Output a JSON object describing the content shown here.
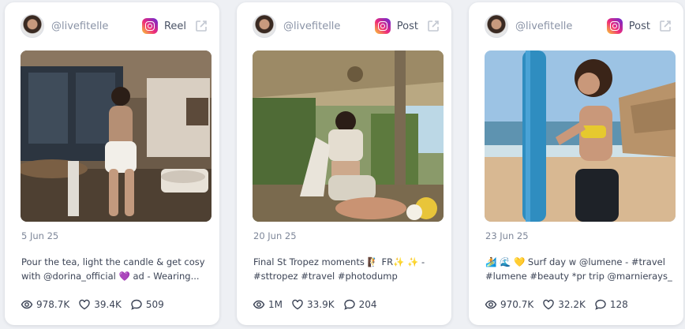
{
  "cards": [
    {
      "handle": "@livefitelle",
      "platform_icon": "instagram-icon",
      "post_type": "Reel",
      "date": "5 Jun 25",
      "caption_line1": "Pour the tea, light the candle & get cosy",
      "caption_line2": "with @dorina_official 💜 ad - Wearing...",
      "views": "978.7K",
      "likes": "39.4K",
      "comments": "509"
    },
    {
      "handle": "@livefitelle",
      "platform_icon": "instagram-icon",
      "post_type": "Post",
      "date": "20 Jun 25",
      "caption_line1": "Final St Tropez moments 🧗 FR✨ ✨ -",
      "caption_line2": "#sttropez #travel #photodump",
      "views": "1M",
      "likes": "33.9K",
      "comments": "204"
    },
    {
      "handle": "@livefitelle",
      "platform_icon": "instagram-icon",
      "post_type": "Post",
      "date": "23 Jun 25",
      "caption_line1": "🏄 🌊 💛 Surf day w @lumene - #travel",
      "caption_line2": "#lumene #beauty *pr trip @marnierays_",
      "views": "970.7K",
      "likes": "32.2K",
      "comments": "128"
    }
  ],
  "colors": {
    "page_background": "#eef0f4",
    "card_background": "#ffffff",
    "muted_text": "#8a93a6",
    "body_text": "#3c4456"
  }
}
